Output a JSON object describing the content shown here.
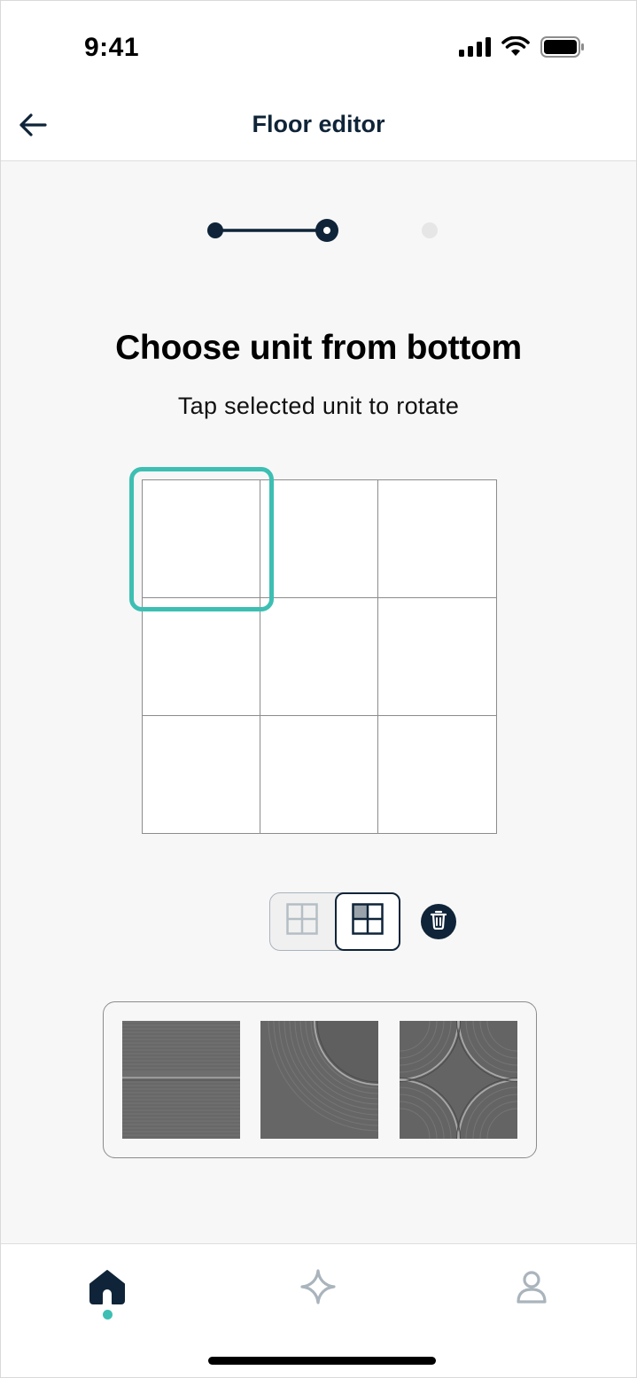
{
  "status_bar": {
    "time": "9:41",
    "icons": [
      "cellular-signal-icon",
      "wifi-icon",
      "battery-icon"
    ]
  },
  "header": {
    "title": "Floor editor",
    "back_icon": "arrow-left-icon"
  },
  "stepper": {
    "total_steps": 3,
    "current_step": 2
  },
  "content": {
    "title": "Choose unit from bottom",
    "subtitle": "Tap selected unit to rotate"
  },
  "floor_grid": {
    "rows": 3,
    "columns": 3,
    "selected_cell": [
      1,
      1
    ]
  },
  "toolbar": {
    "modes": [
      {
        "name": "grid-mode-plain-icon",
        "selected": false
      },
      {
        "name": "grid-mode-quadrant-icon",
        "selected": true
      }
    ],
    "delete_icon": "trash-icon"
  },
  "tiles": [
    {
      "name": "tile-stripe",
      "pattern": "horizontal-band"
    },
    {
      "name": "tile-quarter-arc",
      "pattern": "corner-arc"
    },
    {
      "name": "tile-star",
      "pattern": "four-point-star"
    }
  ],
  "bottom_nav": {
    "items": [
      {
        "name": "home",
        "icon": "home-icon",
        "active": true
      },
      {
        "name": "sparkle",
        "icon": "sparkle-icon",
        "active": false
      },
      {
        "name": "profile",
        "icon": "user-icon",
        "active": false
      }
    ]
  },
  "colors": {
    "primary": "#0f2438",
    "accent": "#3dbfb3",
    "tile_gray": "#6a6a6a",
    "inactive": "#b5bec5"
  }
}
